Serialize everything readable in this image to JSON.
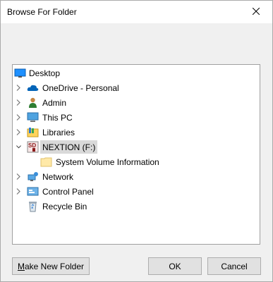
{
  "window": {
    "title": "Browse For Folder",
    "close_icon": "close-icon"
  },
  "tree": {
    "items": [
      {
        "label": "Desktop",
        "icon": "desktop-icon",
        "expander": "none"
      },
      {
        "label": "OneDrive - Personal",
        "icon": "onedrive-cloud-icon",
        "expander": "collapsed"
      },
      {
        "label": "Admin",
        "icon": "user-folder-icon",
        "expander": "collapsed"
      },
      {
        "label": "This PC",
        "icon": "computer-icon",
        "expander": "collapsed"
      },
      {
        "label": "Libraries",
        "icon": "libraries-icon",
        "expander": "collapsed"
      },
      {
        "label": "NEXTION (F:)",
        "icon": "sd-card-drive-icon",
        "expander": "expanded",
        "selected": true
      },
      {
        "label": "System Volume Information",
        "icon": "folder-icon",
        "expander": "none"
      },
      {
        "label": "Network",
        "icon": "network-icon",
        "expander": "collapsed"
      },
      {
        "label": "Control Panel",
        "icon": "control-panel-icon",
        "expander": "collapsed"
      },
      {
        "label": "Recycle Bin",
        "icon": "recycle-bin-icon",
        "expander": "none"
      }
    ]
  },
  "buttons": {
    "new_folder_accel": "M",
    "new_folder_rest": "ake New Folder",
    "ok": "OK",
    "cancel": "Cancel"
  },
  "colors": {
    "selection": "#d9d9d9",
    "folder": "#ffe08a",
    "accent_blue": "#0078d7"
  }
}
